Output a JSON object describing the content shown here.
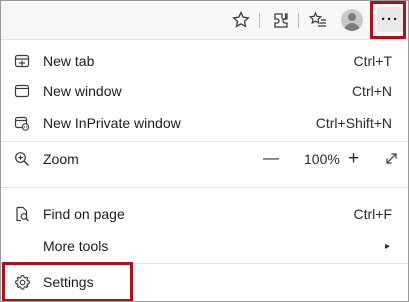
{
  "toolbar": {
    "icons": [
      "favorite-star-icon",
      "extensions-icon",
      "favorites-list-icon",
      "profile-avatar-icon"
    ],
    "more_label": "···"
  },
  "menu": {
    "new_tab": {
      "label": "New tab",
      "shortcut": "Ctrl+T"
    },
    "new_window": {
      "label": "New window",
      "shortcut": "Ctrl+N"
    },
    "new_inprivate": {
      "label": "New InPrivate window",
      "shortcut": "Ctrl+Shift+N"
    },
    "zoom": {
      "label": "Zoom",
      "minus": "—",
      "value": "100%",
      "plus": "+"
    },
    "find": {
      "label": "Find on page",
      "shortcut": "Ctrl+F"
    },
    "more_tools": {
      "label": "More tools",
      "arrow": "▸"
    },
    "settings": {
      "label": "Settings"
    }
  },
  "colors": {
    "highlight": "#a6131c"
  }
}
